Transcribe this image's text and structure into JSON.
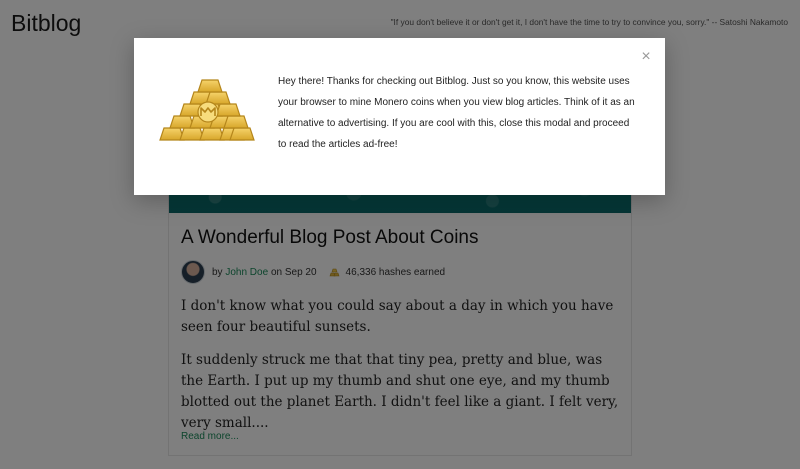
{
  "header": {
    "brand": "Bitblog",
    "quote": "\"If you don't believe it or don't get it, I don't have the time to try to convince you, sorry.\" -- Satoshi Nakamoto"
  },
  "post": {
    "title": "A Wonderful Blog Post About Coins",
    "by_prefix": "by",
    "author": "John Doe",
    "date_text": "on Sep 20",
    "hashes_text": "46,336 hashes earned",
    "paragraphs": [
      "I don't know what you could say about a day in which you have seen four beautiful sunsets.",
      "It suddenly struck me that that tiny pea, pretty and blue, was the Earth. I put up my thumb and shut one eye, and my thumb blotted out the planet Earth. I didn't feel like a giant. I felt very, very small...."
    ],
    "read_more": "Read more..."
  },
  "modal": {
    "close_label": "×",
    "icon": "gold-bars-monero-icon",
    "message": "Hey there! Thanks for checking out Bitblog. Just so you know, this website uses your browser to mine Monero coins when you view blog articles. Think of it as an alternative to advertising. If you are cool with this, close this modal and proceed to read the articles ad-free!"
  },
  "colors": {
    "accent_link": "#1a8a5a",
    "overlay": "rgba(0,0,0,0.5)",
    "gold": "#e0b43a"
  }
}
